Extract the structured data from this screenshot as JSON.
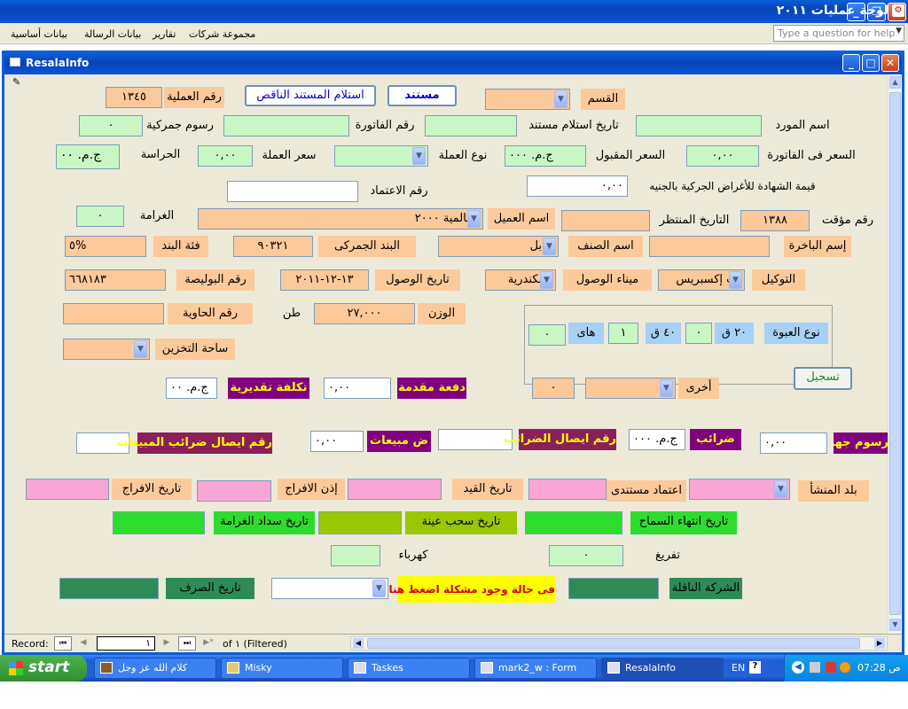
{
  "app": {
    "title": "لوحة عمليات ٢٠١١"
  },
  "menu": {
    "items": [
      "مجموعة شركات",
      "تقارير",
      "بيانات الرسالة",
      "بيانات أساسية"
    ],
    "help_placeholder": "Type a question for help"
  },
  "child": {
    "title": "ResalaInfo"
  },
  "form": {
    "op_no_label": "رقم العملية",
    "op_no_value": "١٣٤٥",
    "btn_doc": "مستند",
    "btn_missing": "استلام المستند الناقص",
    "section_label": "القسم",
    "customs_fees_label": "رسوم جمركية",
    "customs_fees_value": "٠",
    "invoice_no_label": "رقم الفاتورة",
    "doc_receipt_date_label": "تاريخ استلام مستند",
    "supplier_label": "اسم المورد",
    "guard_label": "الحراسة",
    "guard_value": "ج.م. ٠٠",
    "rate_label": "سعر العملة",
    "rate_value": "٠,٠٠",
    "currency_label": "نوع العملة",
    "accepted_price_label": "السعر المقبول",
    "accepted_price_value": "ج.م. ٠٠٠",
    "invoice_price_label": "السعر فى الفاتورة",
    "invoice_price_value": "٠,٠٠",
    "approval_no_label": "رقم الاعتماد",
    "cert_value_label": "قيمة الشهادة للأغراض الجركية بالجنيه",
    "cert_value": "٠,٠٠",
    "fine_label": "الغرامة",
    "fine_value": "٠",
    "client_label": "اسم العميل",
    "client_value": "العالمية ٢٠٠٠",
    "expected_date_label": "التاريخ المنتظر",
    "temp_no_label": "رقم مؤقت",
    "temp_no_value": "١٣٨٨",
    "item_cat_label": "فئة البند",
    "item_cat_value": "٥%",
    "tariff_label": "البند الجمركى",
    "tariff_value": "٩٠٣٢١",
    "category_label": "اسم الصنف",
    "category_value": "توابل",
    "vessel_label": "إسم الباخرة",
    "policy_label": "رقم البوليصة",
    "policy_value": "٦٦٨١٨٣",
    "arrival_date_label": "تاريخ الوصول",
    "arrival_date_value": "١٣-١٢-٢٠١١",
    "port_label": "ميناء الوصول",
    "port_value": "اسكندرية",
    "agency_label": "التوكيل",
    "agency_value": "اب إكسبريس",
    "container_label": "رقم الحاوية",
    "ton_label": "طن",
    "weight_label": "الوزن",
    "weight_value": "٢٧,٠٠٠",
    "pack_label": "نوع العبوة",
    "q20": "٢٠ ق",
    "q20_value": "٠",
    "q40": "٤٠ ق",
    "q40_value": "١",
    "high_label": "هاى",
    "high_value": "٠",
    "other_label": "أخرى",
    "other_value": "٠",
    "register_btn": "تسجيل",
    "storage_label": "ساحة التخزين",
    "est_cost_label": "تكلفة تقديرية",
    "est_cost_value": "ج.م. ٠٠",
    "advance_label": "دفعة مقدمة",
    "advance_value": "٠,٠٠",
    "sales_tax_receipt_label": "رقم ايصال ضرائب المبيعات",
    "sales_tax_label": "ض مبيعات",
    "sales_tax_value": "٠,٠٠",
    "tax_receipt_label": "رقم ايصال الضرائب",
    "taxes_label": "ضرائب",
    "taxes_value": "ج.م. ٠٠٠",
    "entity_fees_label": "رسوم جهات",
    "entity_fees_value": "٠,٠٠",
    "release_date_label": "تاريخ الافراج",
    "release_permit_label": "إذن الافراج",
    "entry_date_label": "تاريخ القيد",
    "doc_approval_label": "اعتماد مستندى",
    "origin_label": "بلد المنشأ",
    "fine_pay_date_label": "تاريخ سداد الغرامة",
    "sample_date_label": "تاريخ سحب عينة",
    "allowance_end_label": "تاريخ انتهاء السماح",
    "electricity_label": "كهرباء",
    "unloading_label": "تفريغ",
    "unloading_value": "٠",
    "disbursement_label": "تاريخ الصرف",
    "problem_label": "فى حالة وجود مشكلة اضغط هنا",
    "carrier_label": "الشركة الناقلة"
  },
  "nav": {
    "record_label": "Record:",
    "record_no": "١",
    "of_label": "of ١ (Filtered)"
  },
  "taskbar": {
    "start": "start",
    "items": [
      "كلام الله عز وجل",
      "Misky",
      "Taskes",
      "mark2_w : Form",
      "ResalaInfo"
    ],
    "lang": "EN",
    "clock": "07:28 ص"
  }
}
